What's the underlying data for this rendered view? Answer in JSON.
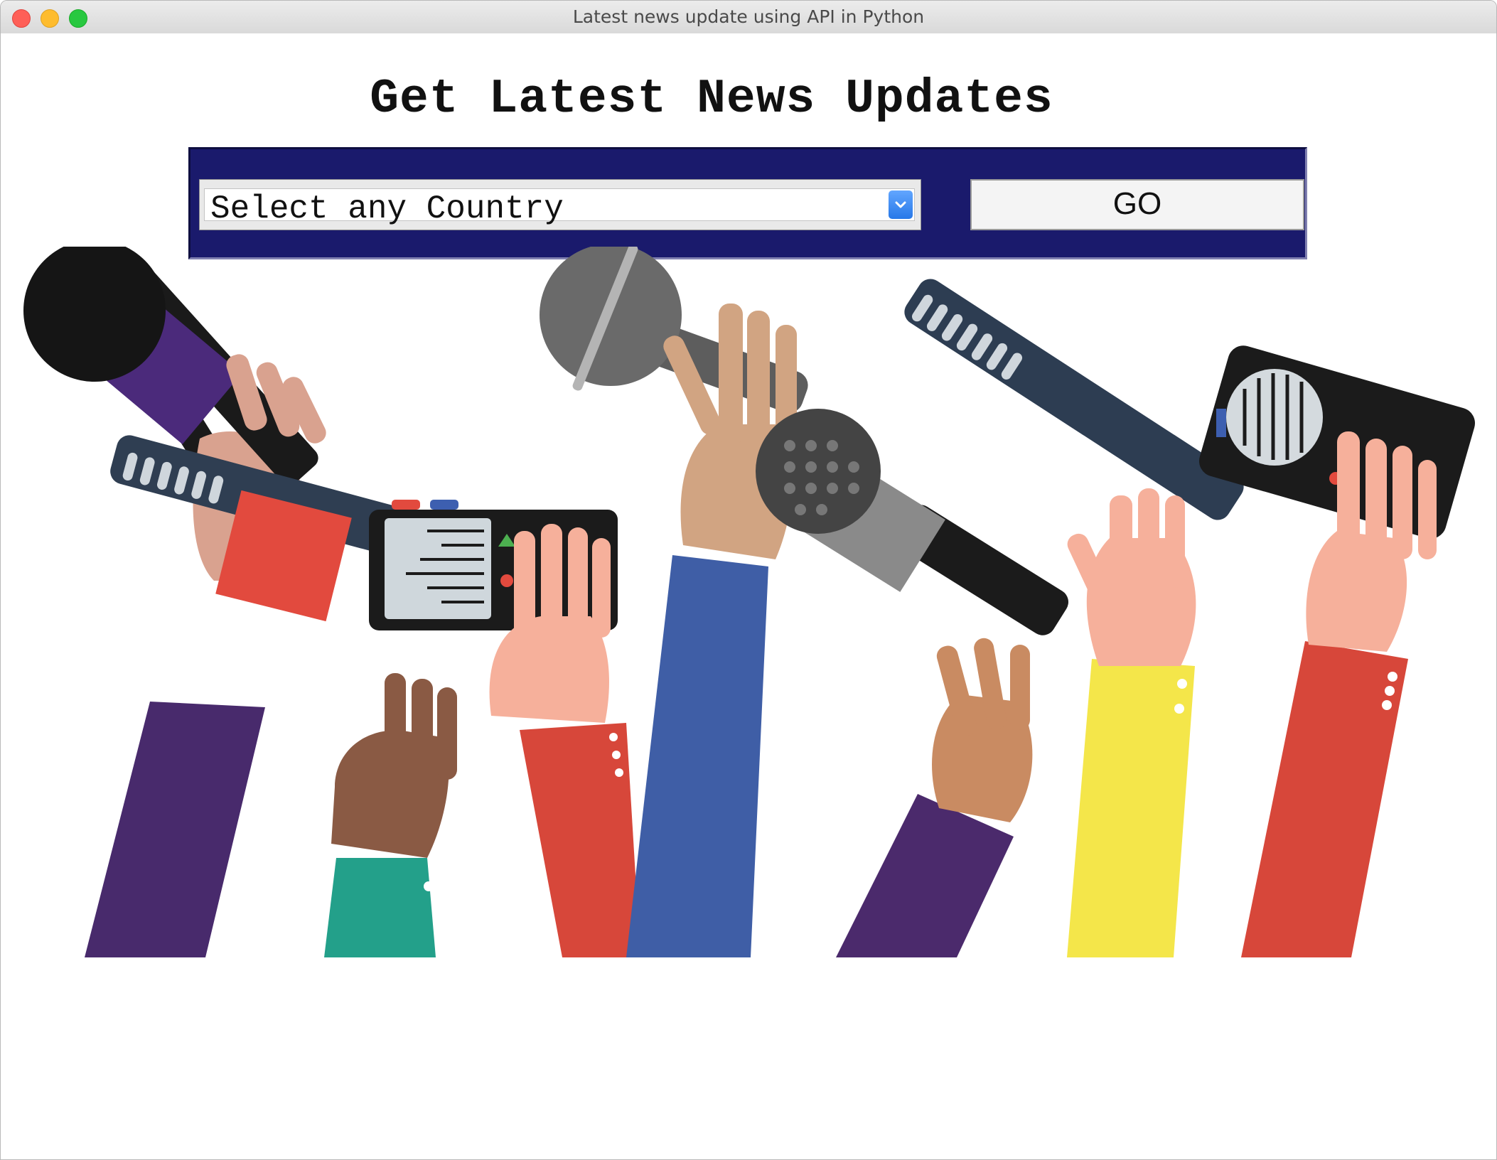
{
  "window": {
    "title": "Latest news update using API in Python"
  },
  "main": {
    "heading": "Get Latest News Updates",
    "country_select": {
      "value": "Select any Country"
    },
    "go_button": {
      "label": "GO"
    }
  },
  "icons": {
    "window_close": "close-icon",
    "window_minimize": "minimize-icon",
    "window_maximize": "maximize-icon",
    "dropdown_arrow": "chevron-down-icon"
  },
  "colors": {
    "panel_background": "#1a1a6c",
    "title_bar": "#dcdcdc",
    "dropdown_arrow": "#2d7de9"
  }
}
